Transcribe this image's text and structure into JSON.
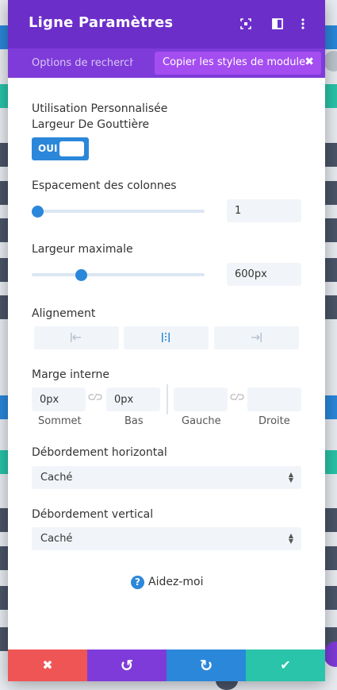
{
  "header": {
    "title": "Ligne Paramètres"
  },
  "subbar": {
    "tab_label": "Options de recherche",
    "copy_label": "Copier les styles de module",
    "close_glyph": "✖"
  },
  "settings": {
    "gutter_label_line1": "Utilisation Personnalisée",
    "gutter_label_line2": "Largeur De Gouttière",
    "toggle_label": "OUI",
    "column_spacing_label": "Espacement des colonnes",
    "column_spacing_value": "1",
    "column_spacing_slider": 0.0,
    "max_width_label": "Largeur maximale",
    "max_width_value": "600px",
    "max_width_slider": 0.25,
    "alignment_label": "Alignement",
    "padding_label": "Marge interne",
    "padding": {
      "top_value": "0px",
      "bottom_value": "0px",
      "left_value": "",
      "right_value": "",
      "top_label": "Sommet",
      "bottom_label": "Bas",
      "left_label": "Gauche",
      "right_label": "Droite"
    },
    "overflow_x_label": "Débordement horizontal",
    "overflow_x_value": "Caché",
    "overflow_y_label": "Débordement vertical",
    "overflow_y_value": "Caché"
  },
  "help": {
    "label": "Aidez-moi",
    "glyph": "?"
  },
  "footer": {
    "cancel_glyph": "✖",
    "undo_glyph": "↺",
    "redo_glyph": "↻",
    "save_glyph": "✔",
    "colors": {
      "cancel": "#ef5555",
      "undo": "#7e3bd9",
      "redo": "#2b87da",
      "save": "#29c4a9"
    }
  },
  "colors": {
    "accent": "#2b87da",
    "header": "#6c2ec9",
    "subbar": "#7e3bd9",
    "copy_pill": "#a44df0"
  }
}
